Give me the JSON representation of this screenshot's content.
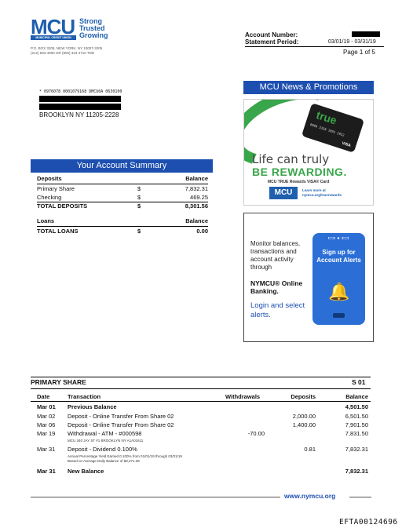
{
  "logo": {
    "mark": "MCU",
    "sub": "MUNICIPAL CREDIT UNION",
    "tagline": [
      "Strong",
      "Trusted",
      "Growing"
    ],
    "address": [
      "P.O. BOX 3205, NEW YORK, NY 10007-3205",
      "(212) 693-4900 OR (800) 323-4710 TDD"
    ]
  },
  "account": {
    "number_label": "Account Number:",
    "period_label": "Statement Period:",
    "period_value": "03/01/19 - 03/31/19",
    "page": "Page  1 of 5"
  },
  "address": {
    "barcode": "* 0976078 0001079168 DMCU0A 0630100",
    "city": "BROOKLYN NY 11205-2228"
  },
  "summary": {
    "title": "Your Account Summary",
    "deposits_header": "Deposits",
    "balance_header": "Balance",
    "rows": [
      {
        "label": "Primary Share",
        "cur": "$",
        "amount": "7,832.31"
      },
      {
        "label": "Checking",
        "cur": "$",
        "amount": "469.25"
      }
    ],
    "total_deposits": {
      "label": "TOTAL DEPOSITS",
      "cur": "$",
      "amount": "8,301.56"
    },
    "loans_header": "Loans",
    "loans_balance_header": "Balance",
    "total_loans": {
      "label": "TOTAL LOANS",
      "cur": "$",
      "amount": "0.00"
    }
  },
  "news": {
    "title": "MCU News & Promotions",
    "card_brand": "true",
    "card_number": "0000 3358 1892 2952",
    "card_network": "VISA",
    "line1": "Life can truly",
    "line2": "BE REWARDING.",
    "line3": "MCU TRUE Rewards VISA® Card",
    "promo_logo": "MCU",
    "learn": [
      "Learn more at",
      "nymcu.org/truerewards"
    ]
  },
  "alerts": {
    "text": "Monitor balances, transactions and account activity through",
    "nymcu": "NYMCU® Online Banking.",
    "login": "Login and select alerts.",
    "phone_text": "Sign up for Account Alerts",
    "bell": "🔔"
  },
  "primary_share": {
    "title": "PRIMARY SHARE",
    "code": "S 01",
    "headers": {
      "date": "Date",
      "transaction": "Transaction",
      "withdrawals": "Withdrawals",
      "deposits": "Deposits",
      "balance": "Balance"
    },
    "rows": [
      {
        "date": "Mar 01",
        "desc": "Previous Balance",
        "w": "",
        "d": "",
        "b": "4,501.50",
        "bold": true
      },
      {
        "date": "Mar 02",
        "desc": "Deposit - Online Transfer From Share 02",
        "w": "",
        "d": "2,000.00",
        "b": "6,501.50"
      },
      {
        "date": "Mar 06",
        "desc": "Deposit - Online Transfer From Share 02",
        "w": "",
        "d": "1,400.00",
        "b": "7,901.50"
      },
      {
        "date": "Mar 19",
        "desc": "Withdrawal - ATM - #000598",
        "w": "-70.00",
        "d": "",
        "b": "7,831.50"
      },
      {
        "date": "Mar 31",
        "desc": "Deposit - Dividend 0.100%",
        "w": "",
        "d": "0.81",
        "b": "7,832.31"
      },
      {
        "date": "Mar 31",
        "desc": "New Balance",
        "w": "",
        "d": "",
        "b": "7,832.31",
        "bold": true
      }
    ],
    "atm_sub": "MCU 340 JAY ST #1 BROOKLYN NY A1A01611",
    "div_sub1": "Annual Percentage Yield Earned 0.100% from 01/01/19 through 03/31/19",
    "div_sub2": "Based on Average Daily Balance of $3,271.39"
  },
  "footer": {
    "url": "www.nymcu.org",
    "doc_id": "EFTA00124696"
  }
}
